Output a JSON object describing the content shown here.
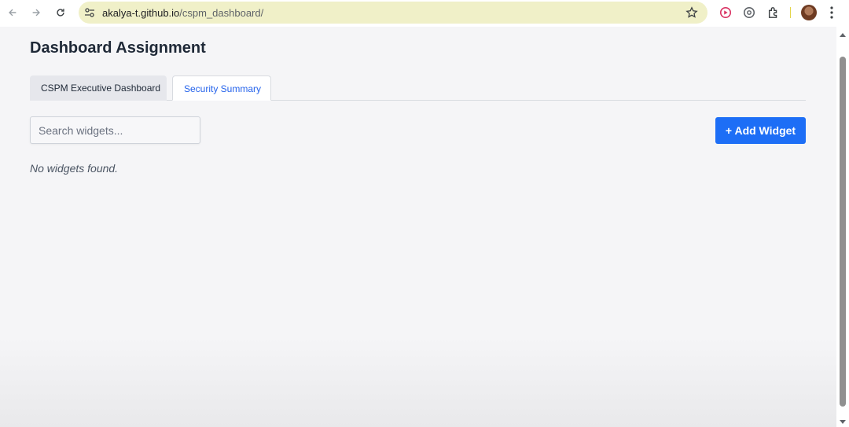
{
  "browser": {
    "url_host": "akalya-t.github.io",
    "url_path": "/cspm_dashboard/"
  },
  "page": {
    "title": "Dashboard Assignment",
    "tabs": [
      {
        "label": "CSPM Executive Dashboard",
        "active": false
      },
      {
        "label": "Security Summary",
        "active": true
      }
    ],
    "search": {
      "placeholder": "Search widgets...",
      "value": ""
    },
    "add_widget_label": "+ Add Widget",
    "empty_message": "No widgets found."
  },
  "colors": {
    "accent": "#1d6ef6",
    "active_tab_text": "#2563eb",
    "omnibox": "#f0f0c8"
  },
  "icons": [
    "back-icon",
    "forward-icon",
    "reload-icon",
    "site-info-icon",
    "star-icon",
    "record-extension-icon",
    "grammar-extension-icon",
    "puzzle-extensions-icon",
    "avatar",
    "kebab-menu-icon"
  ]
}
